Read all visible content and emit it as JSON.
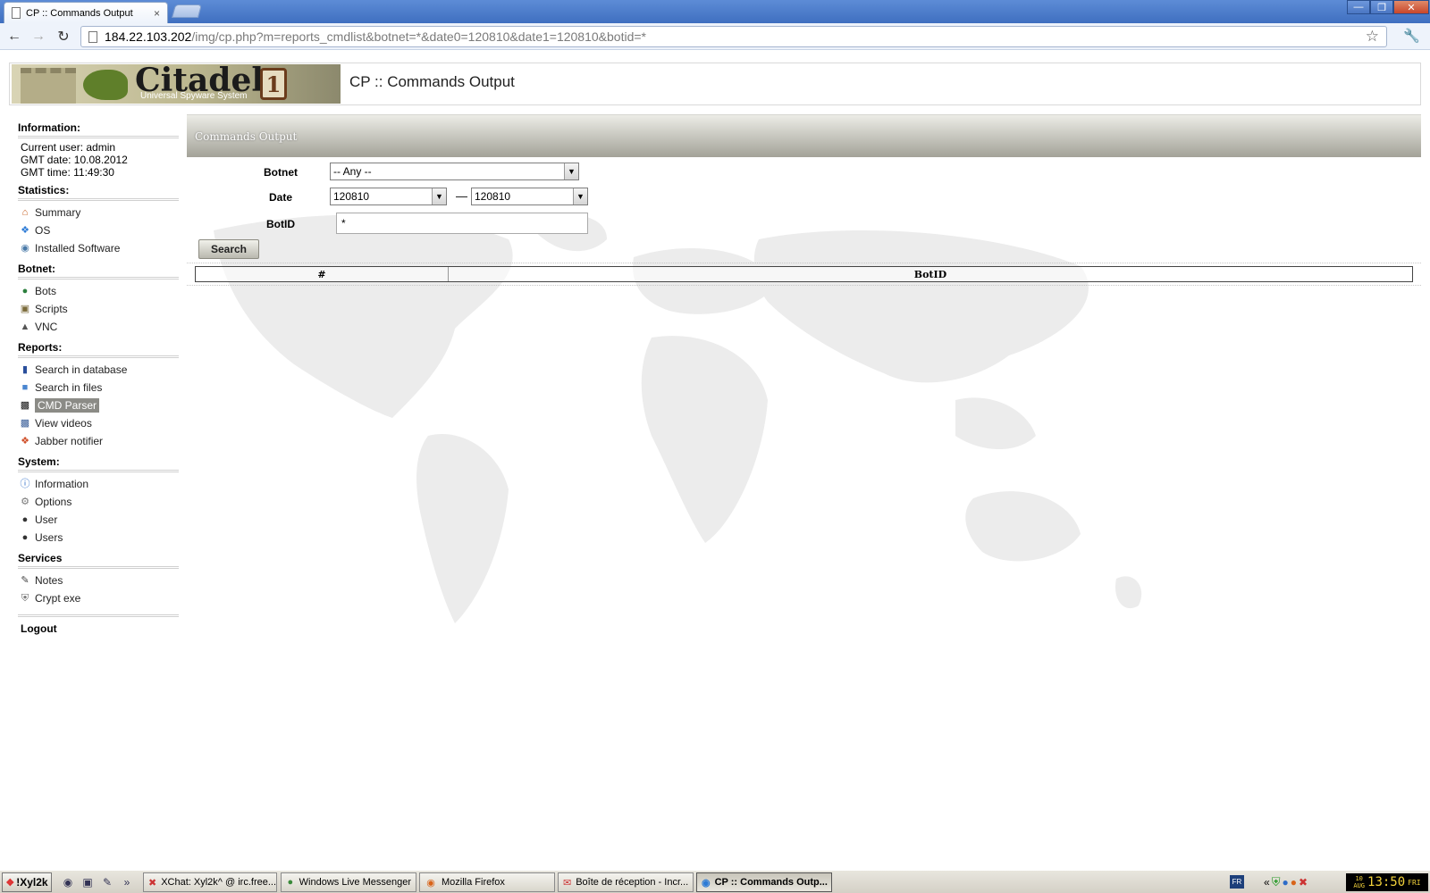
{
  "browser": {
    "tab_title": "CP :: Commands Output",
    "tab_close": "×",
    "url_host": "184.22.103.202",
    "url_path": "/img/cp.php?m=reports_cmdlist&botnet=*&date0=120810&date1=120810&botid=*"
  },
  "logo": {
    "brand": "Citadel",
    "version": "1",
    "tagline": "Universal Spyware System"
  },
  "header": {
    "title": "CP :: Commands Output"
  },
  "sidebar": {
    "information": {
      "heading": "Information:",
      "current_user": "Current user: admin",
      "gmt_date": "GMT date: 10.08.2012",
      "gmt_time": "GMT time: 11:49:30"
    },
    "statistics": {
      "heading": "Statistics:",
      "items": [
        "Summary",
        "OS",
        "Installed Software"
      ]
    },
    "botnet": {
      "heading": "Botnet:",
      "items": [
        "Bots",
        "Scripts",
        "VNC"
      ]
    },
    "reports": {
      "heading": "Reports:",
      "items": [
        "Search in database",
        "Search in files",
        "CMD Parser",
        "View videos",
        "Jabber notifier"
      ]
    },
    "system": {
      "heading": "System:",
      "items": [
        "Information",
        "Options",
        "User",
        "Users"
      ]
    },
    "services": {
      "heading": "Services",
      "items": [
        "Notes",
        "Crypt exe"
      ]
    },
    "logout": "Logout"
  },
  "panel": {
    "title": "Commands Output",
    "botnet_label": "Botnet",
    "botnet_value": "-- Any --",
    "date_label": "Date",
    "date_from": "120810",
    "date_separator": "—",
    "date_to": "120810",
    "botid_label": "BotID",
    "botid_value": "*",
    "search_button": "Search",
    "table_headers": [
      "#",
      "BotID"
    ]
  },
  "taskbar": {
    "start_label": "!Xyl2k",
    "quick_launch_more": "»",
    "tasks": [
      "XChat: Xyl2k^ @ irc.free...",
      "Windows Live Messenger",
      "Mozilla Firefox",
      "Boîte de réception - Incr...",
      "CP :: Commands Outp..."
    ],
    "lang": "FR",
    "tray_arrow": "«",
    "clock_date_day": "10",
    "clock_date_month": "AUG",
    "clock_time": "13:50",
    "clock_weekday": "FRI"
  },
  "colors": {
    "panel_head_dark": "#a3a298",
    "active_item_bg": "#8b8b86",
    "titlebar": "#3f6fc0",
    "clock_text": "#f3d33b"
  }
}
